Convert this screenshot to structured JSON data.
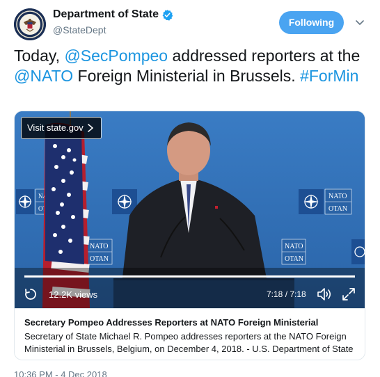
{
  "account": {
    "display_name": "Department of State",
    "handle": "@StateDept",
    "avatar_icon": "state-department-seal-icon",
    "verified_icon": "verified-badge-icon",
    "follow_label": "Following",
    "menu_icon": "chevron-down-icon"
  },
  "tweet": {
    "parts": {
      "p1": "Today, ",
      "mention1": "@SecPompeo",
      "p2": " addressed reporters at the ",
      "mention2": "@NATO",
      "p3": " Foreign Ministerial in Brussels. ",
      "hashtag": "#ForMin"
    },
    "timestamp": "10:36 PM - 4 Dec 2018"
  },
  "media": {
    "visit_label": "Visit state.gov",
    "views": "12.2K views",
    "timecode": "7:18 / 7:18",
    "progress": 1.0,
    "backdrop_text": "NATO",
    "backdrop_text2": "OTAN",
    "icons": {
      "replay": "replay-icon",
      "volume": "volume-icon",
      "fullscreen": "fullscreen-icon",
      "visit_chevron": "chevron-right-icon"
    }
  },
  "card": {
    "title": "Secretary Pompeo Addresses Reporters at NATO Foreign Ministerial",
    "description": "Secretary of State Michael R. Pompeo addresses reporters at the NATO Foreign Ministerial in Brussels, Belgium, on December 4, 2018. - U.S. Department of State"
  },
  "colors": {
    "link": "#1b95e0",
    "follow_button": "#4aa4f1",
    "backdrop": "#2d6fb6",
    "muted_text": "#657786"
  }
}
